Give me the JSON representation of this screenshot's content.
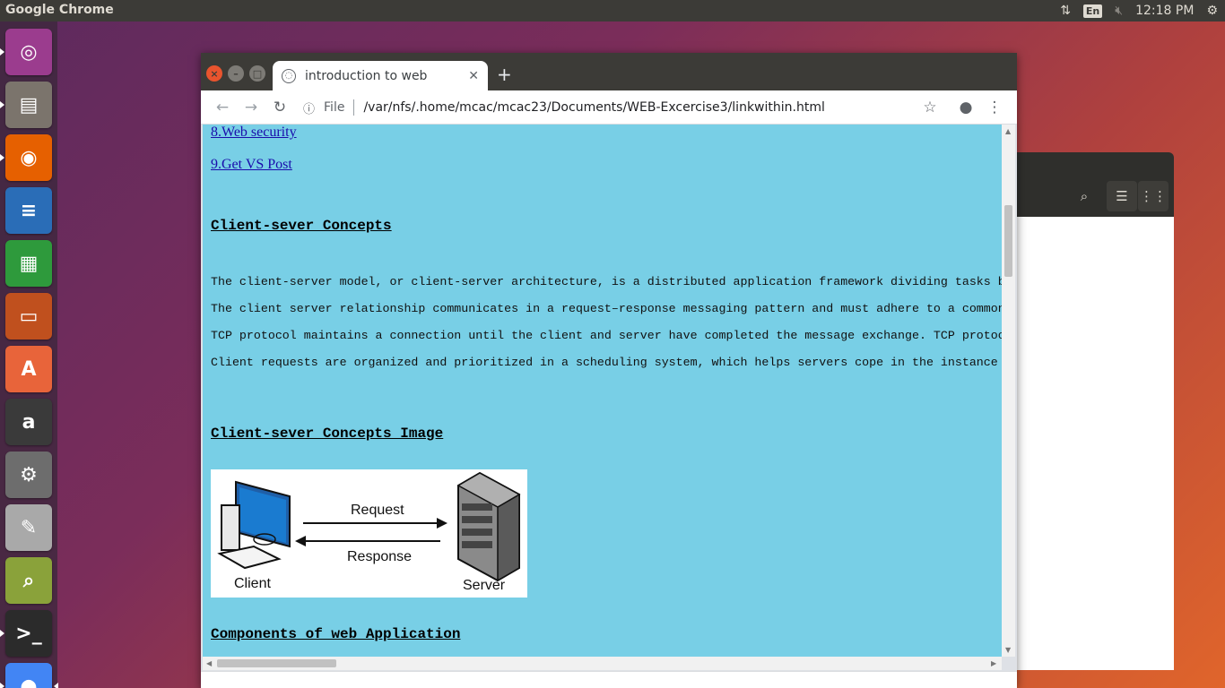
{
  "top_panel": {
    "app_name": "Google Chrome",
    "language": "En",
    "time": "12:18 PM"
  },
  "launcher": {
    "items": [
      {
        "name": "ubuntu-dash-icon",
        "glyph": "◎",
        "color": "#9b3c8e"
      },
      {
        "name": "files-icon",
        "glyph": "▤",
        "color": "#7b746c"
      },
      {
        "name": "firefox-icon",
        "glyph": "◉",
        "color": "#e66000"
      },
      {
        "name": "writer-icon",
        "glyph": "≡",
        "color": "#2a6db7"
      },
      {
        "name": "calc-icon",
        "glyph": "▦",
        "color": "#2e9a3c"
      },
      {
        "name": "impress-icon",
        "glyph": "▭",
        "color": "#c0501e"
      },
      {
        "name": "software-center-icon",
        "glyph": "A",
        "color": "#e8643a"
      },
      {
        "name": "amazon-icon",
        "glyph": "a",
        "color": "#3a3a3a"
      },
      {
        "name": "system-settings-icon",
        "glyph": "⚙",
        "color": "#6d6d6d"
      },
      {
        "name": "text-editor-icon",
        "glyph": "✎",
        "color": "#a9a9a9"
      },
      {
        "name": "search-tool-icon",
        "glyph": "⌕",
        "color": "#8aa23a"
      },
      {
        "name": "terminal-icon",
        "glyph": ">_",
        "color": "#2b2b2b"
      },
      {
        "name": "chrome-icon",
        "glyph": "●",
        "color": "#4285f4"
      }
    ]
  },
  "browser": {
    "tab_title": "introduction to web",
    "new_tab": "+",
    "scheme": "File",
    "url": "/var/nfs/.home/mcac/mcac23/Documents/WEB-Excercise3/linkwithin.html"
  },
  "page": {
    "links": [
      "8.Web security",
      "9.Get VS Post"
    ],
    "heading_concepts": "Client-sever Concepts",
    "paragraphs": [
      "The client-server model, or client-server architecture, is a distributed application framework dividing tasks bet",
      "The client server relationship communicates in a request–response messaging pattern and must adhere to a common c",
      "TCP protocol maintains a connection until the client and server have completed the message exchange. TCP protocol",
      "Client requests are organized and prioritized in a scheduling system, which helps servers cope in the instance of"
    ],
    "heading_image": "Client-sever Concepts Image",
    "diagram": {
      "request": "Request",
      "response": "Response",
      "client": "Client",
      "server": "Server"
    },
    "heading_components": "Components of web Application"
  }
}
